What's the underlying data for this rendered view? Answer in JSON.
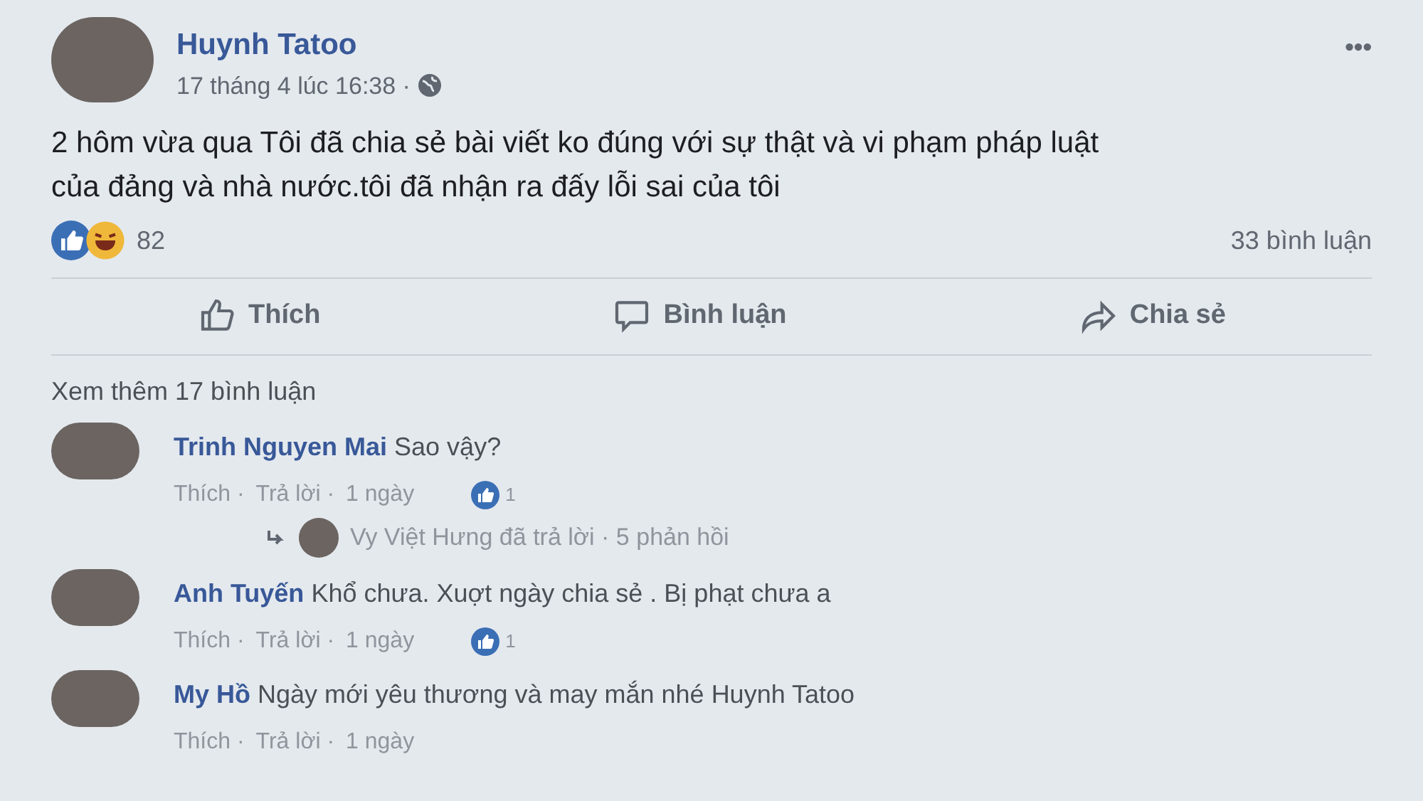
{
  "post": {
    "author": "Huynh Tatoo",
    "time": "17 tháng 4 lúc 16:38 ·",
    "more": "•••",
    "text": "2 hôm vừa qua Tôi đã chia sẻ bài viết ko đúng với sự thật và vi phạm pháp luật của đảng và nhà nước.tôi đã nhận ra đấy lỗi sai của tôi",
    "reaction_count": "82",
    "comment_count": "33 bình luận"
  },
  "actions": [
    {
      "kind": "like",
      "label": "Thích"
    },
    {
      "kind": "comment",
      "label": "Bình luận"
    },
    {
      "kind": "share",
      "label": "Chia sẻ"
    }
  ],
  "more_comments": "Xem thêm 17 bình luận",
  "comments": [
    {
      "name": "Trinh Nguyen Mai",
      "text": "Sao vậy?",
      "like": "Thích ·",
      "reply": "Trả lời ·",
      "time": "1 ngày",
      "likes": "1",
      "replies": {
        "text": "Vy Việt Hưng đã trả lời · 5 phản hồi"
      }
    },
    {
      "name": "Anh Tuyến",
      "text": "Khổ chưa. Xuợt ngày chia sẻ . Bị phạt chưa a",
      "like": "Thích ·",
      "reply": "Trả lời ·",
      "time": "1 ngày",
      "likes": "1"
    },
    {
      "name": "My Hồ",
      "text": "Ngày mới yêu thương và may mắn nhé Huynh Tatoo",
      "like": "Thích ·",
      "reply": "Trả lời ·",
      "time": "1 ngày"
    }
  ]
}
